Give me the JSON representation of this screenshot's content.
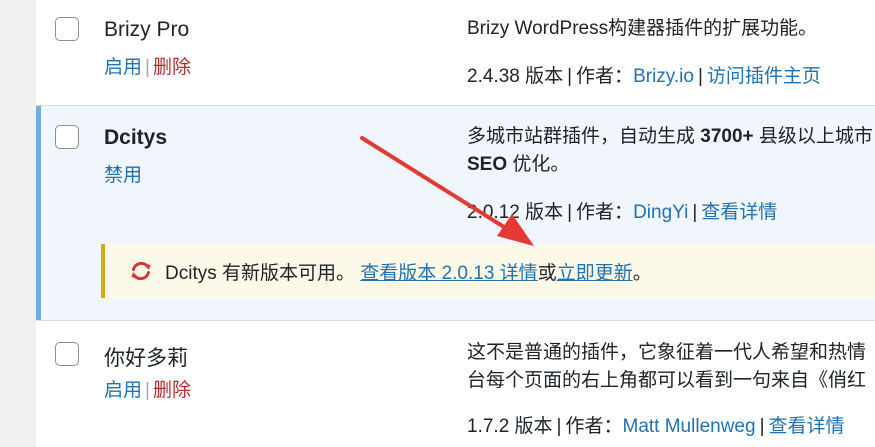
{
  "plugins": [
    {
      "name": "Brizy Pro",
      "actions": [
        "启用",
        "删除"
      ],
      "description_lines": [
        "Brizy WordPress构建器插件的扩展功能。"
      ],
      "version": "2.4.38 版本",
      "author_label": "作者：",
      "author": "Brizy.io",
      "extra_link": "访问插件主页"
    },
    {
      "name": "Dcitys",
      "actions": [
        "禁用"
      ],
      "description_line1_pre": "多城市站群插件，自动生成 ",
      "description_line1_bold": "3700+",
      "description_line1_post": " 县级以上城市",
      "description_line2_bold": "SEO",
      "description_line2_post": " 优化。",
      "version": "2.0.12 版本",
      "author_label": "作者：",
      "author": "DingYi",
      "extra_link": "查看详情",
      "update_notice": {
        "prefix": "Dcitys 有新版本可用。",
        "details_link": "查看版本 2.0.13 详情",
        "or": "或",
        "update_link": "立即更新",
        "suffix": "。"
      }
    },
    {
      "name": "你好多莉",
      "actions": [
        "启用",
        "删除"
      ],
      "description_lines": [
        "这不是普通的插件，它象征着一代人希望和热情",
        "台每个页面的右上角都可以看到一句来自《俏红"
      ],
      "version": "1.7.2 版本",
      "author_label": "作者：",
      "author": "Matt Mullenweg",
      "extra_link": "查看详情"
    }
  ],
  "colors": {
    "link": "#2271b1",
    "delete": "#b32d2e",
    "active_bar": "#72aee6",
    "notice_border": "#dba617",
    "arrow": "#e53935",
    "update_icon": "#d63638"
  },
  "icons": {
    "update": "update-icon",
    "arrow": "annotation-arrow"
  }
}
